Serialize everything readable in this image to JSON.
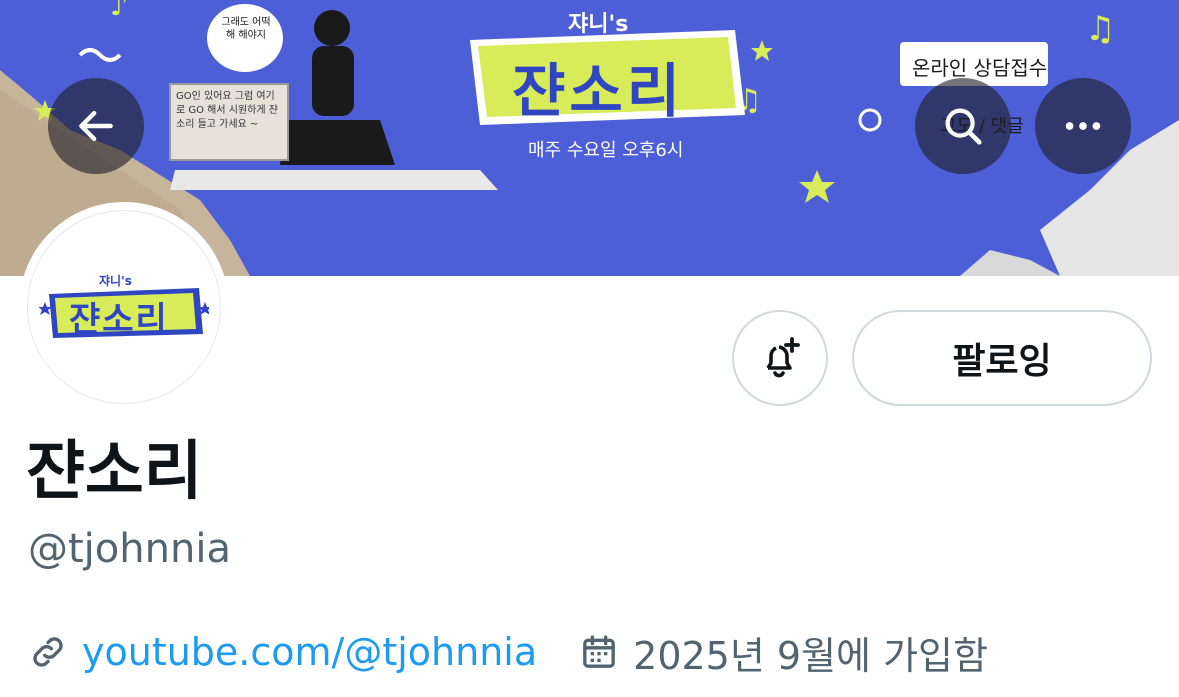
{
  "banner": {
    "show_label_small": "쟈니's",
    "show_title": "쟌소리",
    "schedule_text": "매주 수요일 오후6시",
    "consult_text": "온라인 상담접수",
    "dm_text": "그도 / 댓글",
    "speech_bubble": "그래도 어떡해 해야지",
    "sign_text": "GO인 있어요 그럼 여기로 GO 해서 시원하게 쟌소리 들고 가세요 ~",
    "bg_color": "#4d5fd6",
    "title_color": "#d8ec5a"
  },
  "nav": {
    "back_icon": "arrow-left-icon",
    "search_icon": "search-icon",
    "more_icon": "more-horizontal-icon"
  },
  "avatar": {
    "logo_small": "쟈니's",
    "logo_title": "쟌소리"
  },
  "actions": {
    "notify_icon": "bell-plus-icon",
    "follow_label": "팔로잉"
  },
  "profile": {
    "display_name": "쟌소리",
    "handle": "@tjohnnia",
    "link_text": "youtube.com/@tjohnnia",
    "joined_text": "2025년 9월에 가입함"
  },
  "colors": {
    "link": "#1d9bf0",
    "secondary_text": "#536471",
    "primary_text": "#0f1419",
    "button_border": "#cfd9de"
  }
}
